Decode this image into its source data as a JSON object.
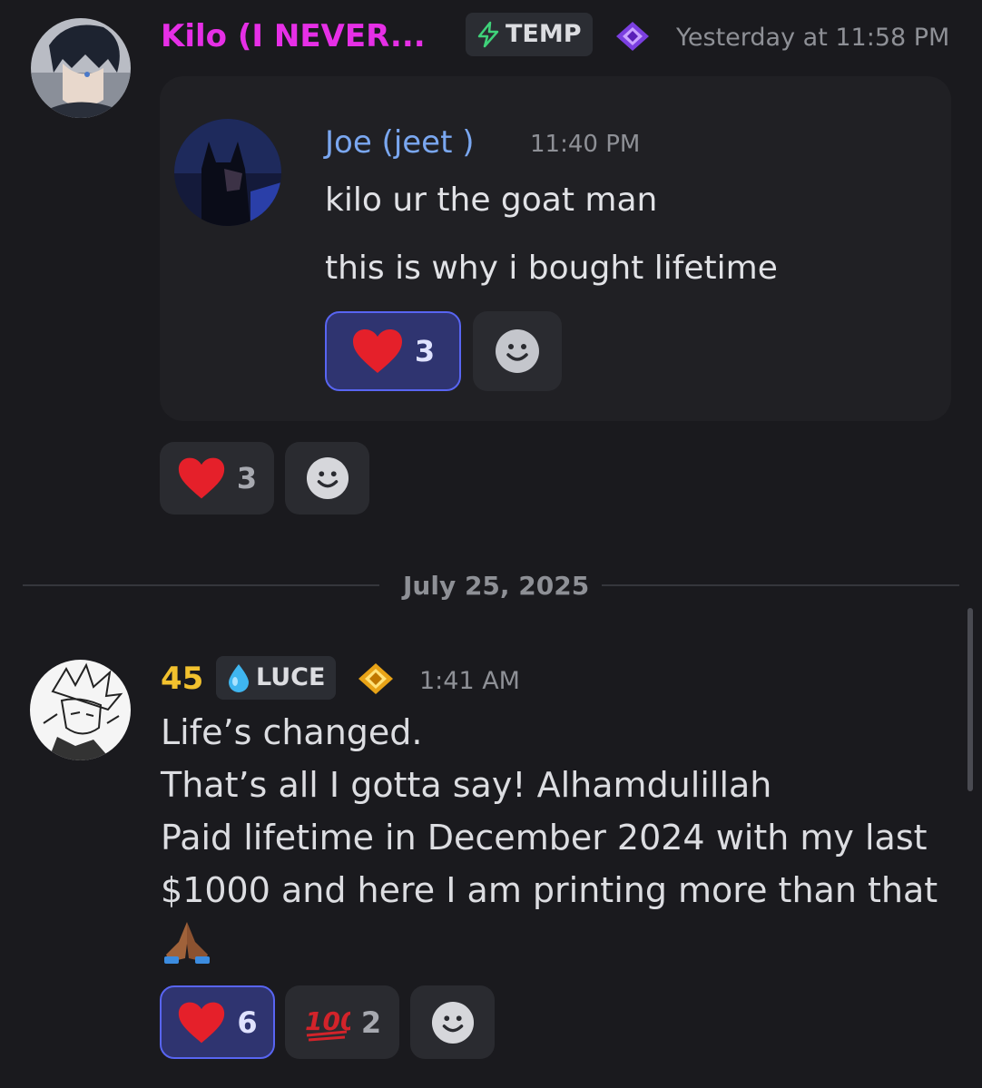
{
  "colors": {
    "background": "#1a1a1e",
    "kilo_name": "#e62fe6",
    "user45_name": "#f2c12e",
    "joe_name": "#7aa7f0",
    "reaction_active_bg": "#2f3470",
    "reaction_active_border": "#5865f2",
    "heart": "#e5202a",
    "hundred": "#d2232a"
  },
  "message1": {
    "author": "Kilo (I NEVER...",
    "tag": {
      "icon": "lightning-icon",
      "label": "TEMP"
    },
    "badge_icon": "purple-gem-badge-icon",
    "timestamp": "Yesterday at 11:58 PM",
    "embed": {
      "author": "Joe (jeet )",
      "timestamp": "11:40 PM",
      "lines": [
        "kilo ur the goat man",
        "this is why i bought lifetime"
      ],
      "reactions": [
        {
          "emoji": "heart",
          "count": "3"
        }
      ]
    },
    "reactions": [
      {
        "emoji": "heart",
        "count": "3"
      }
    ]
  },
  "date_divider": "July 25, 2025",
  "message2": {
    "author": "45",
    "tag": {
      "icon": "water-drop-icon",
      "label": "LUCE"
    },
    "badge_icon": "gold-gem-badge-icon",
    "timestamp": "1:41 AM",
    "lines": [
      "Life’s changed.",
      "That’s all I gotta say! Alhamdulillah",
      "Paid lifetime in December 2024 with my last",
      "$1000 and here I am printing more than that",
      "🙏🏾"
    ],
    "reactions": [
      {
        "emoji": "heart",
        "count": "6"
      },
      {
        "emoji": "hundred-points",
        "count": "2"
      }
    ]
  }
}
